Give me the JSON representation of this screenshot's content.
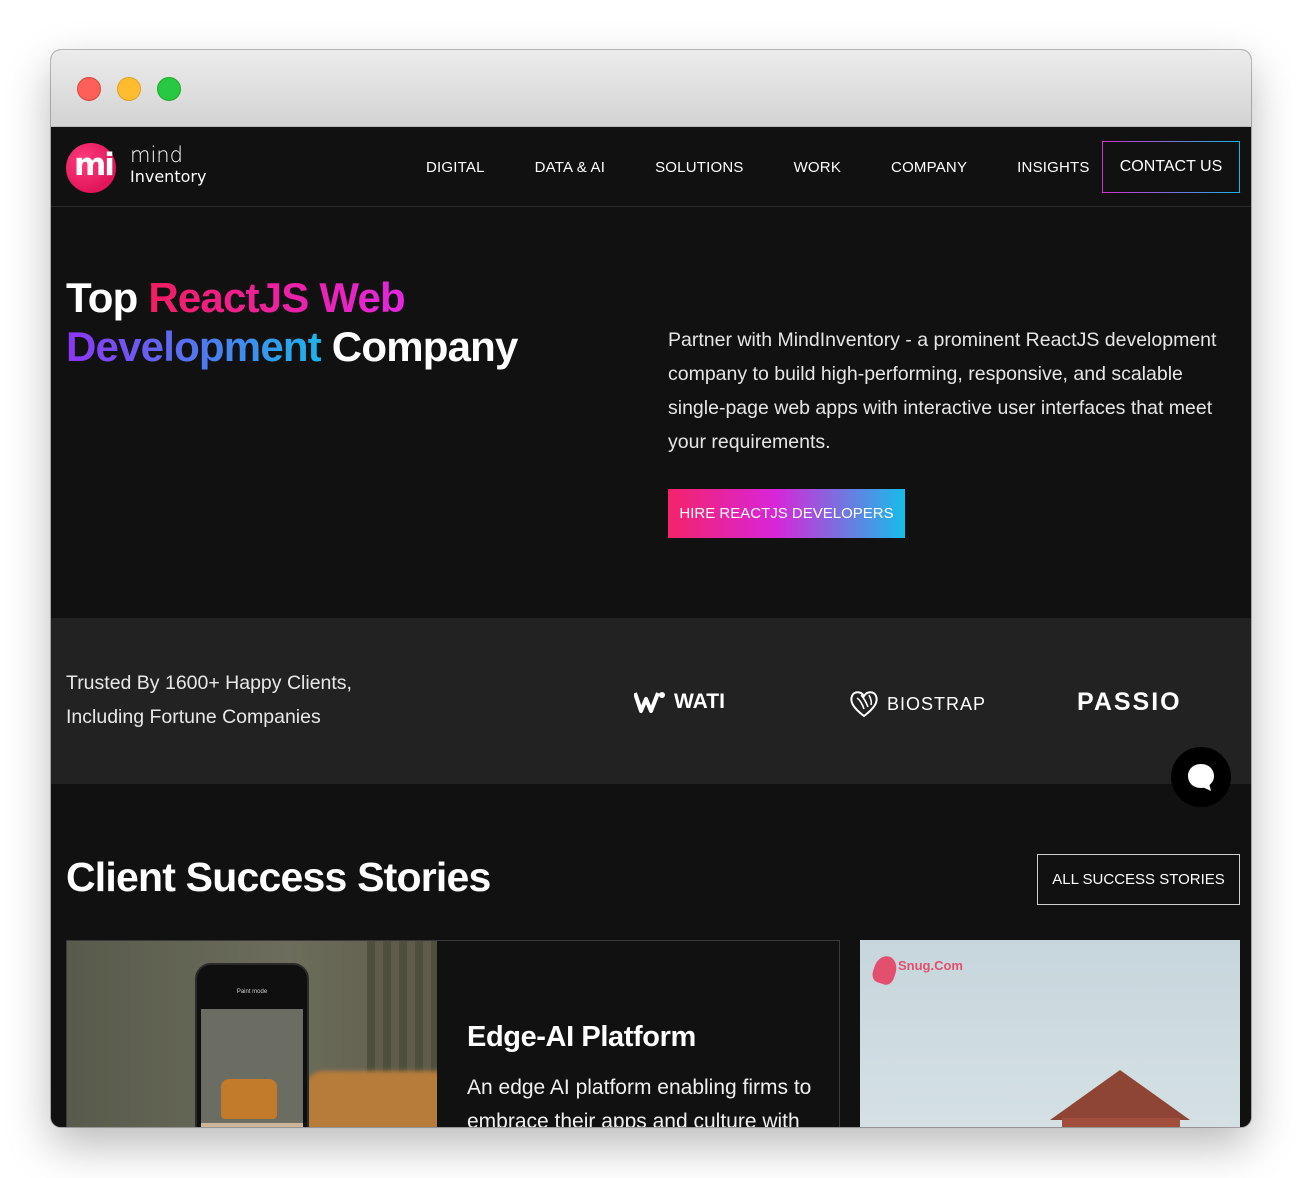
{
  "window": {
    "controls": [
      "close",
      "minimize",
      "maximize"
    ]
  },
  "brand": {
    "mark": "mi",
    "line1": "mind",
    "line2": "Inventory"
  },
  "nav": {
    "items": [
      "DIGITAL",
      "DATA & AI",
      "SOLUTIONS",
      "WORK",
      "COMPANY",
      "INSIGHTS"
    ],
    "cta": "CONTACT US"
  },
  "hero": {
    "title_part1": "Top ",
    "title_part2": "ReactJS Web",
    "title_part3": "Development",
    "title_part4": " Company",
    "description": "Partner with MindInventory - a prominent ReactJS development company to build high-performing, responsive, and scalable single-page web apps with interactive user interfaces that meet your requirements.",
    "cta": "HIRE REACTJS DEVELOPERS"
  },
  "trusted": {
    "line1": "Trusted By 1600+ Happy Clients,",
    "line2": "Including Fortune Companies",
    "clients": [
      "WATI",
      "BIOSTRAP",
      "PASSIO"
    ]
  },
  "stories": {
    "title": "Client Success Stories",
    "all_label": "ALL SUCCESS STORIES",
    "cards": [
      {
        "heading": "Edge-AI Platform",
        "description": "An edge AI platform enabling firms to embrace their apps and culture with AI-driven UX.",
        "phone_title": "Paint mode"
      },
      {
        "brand": "Snug.Com"
      }
    ]
  },
  "colors": {
    "accent_pink": "#f41d5f",
    "accent_magenta": "#e326e0",
    "accent_purple": "#8d35f5",
    "accent_blue": "#1bb4ea",
    "background": "#111112"
  }
}
